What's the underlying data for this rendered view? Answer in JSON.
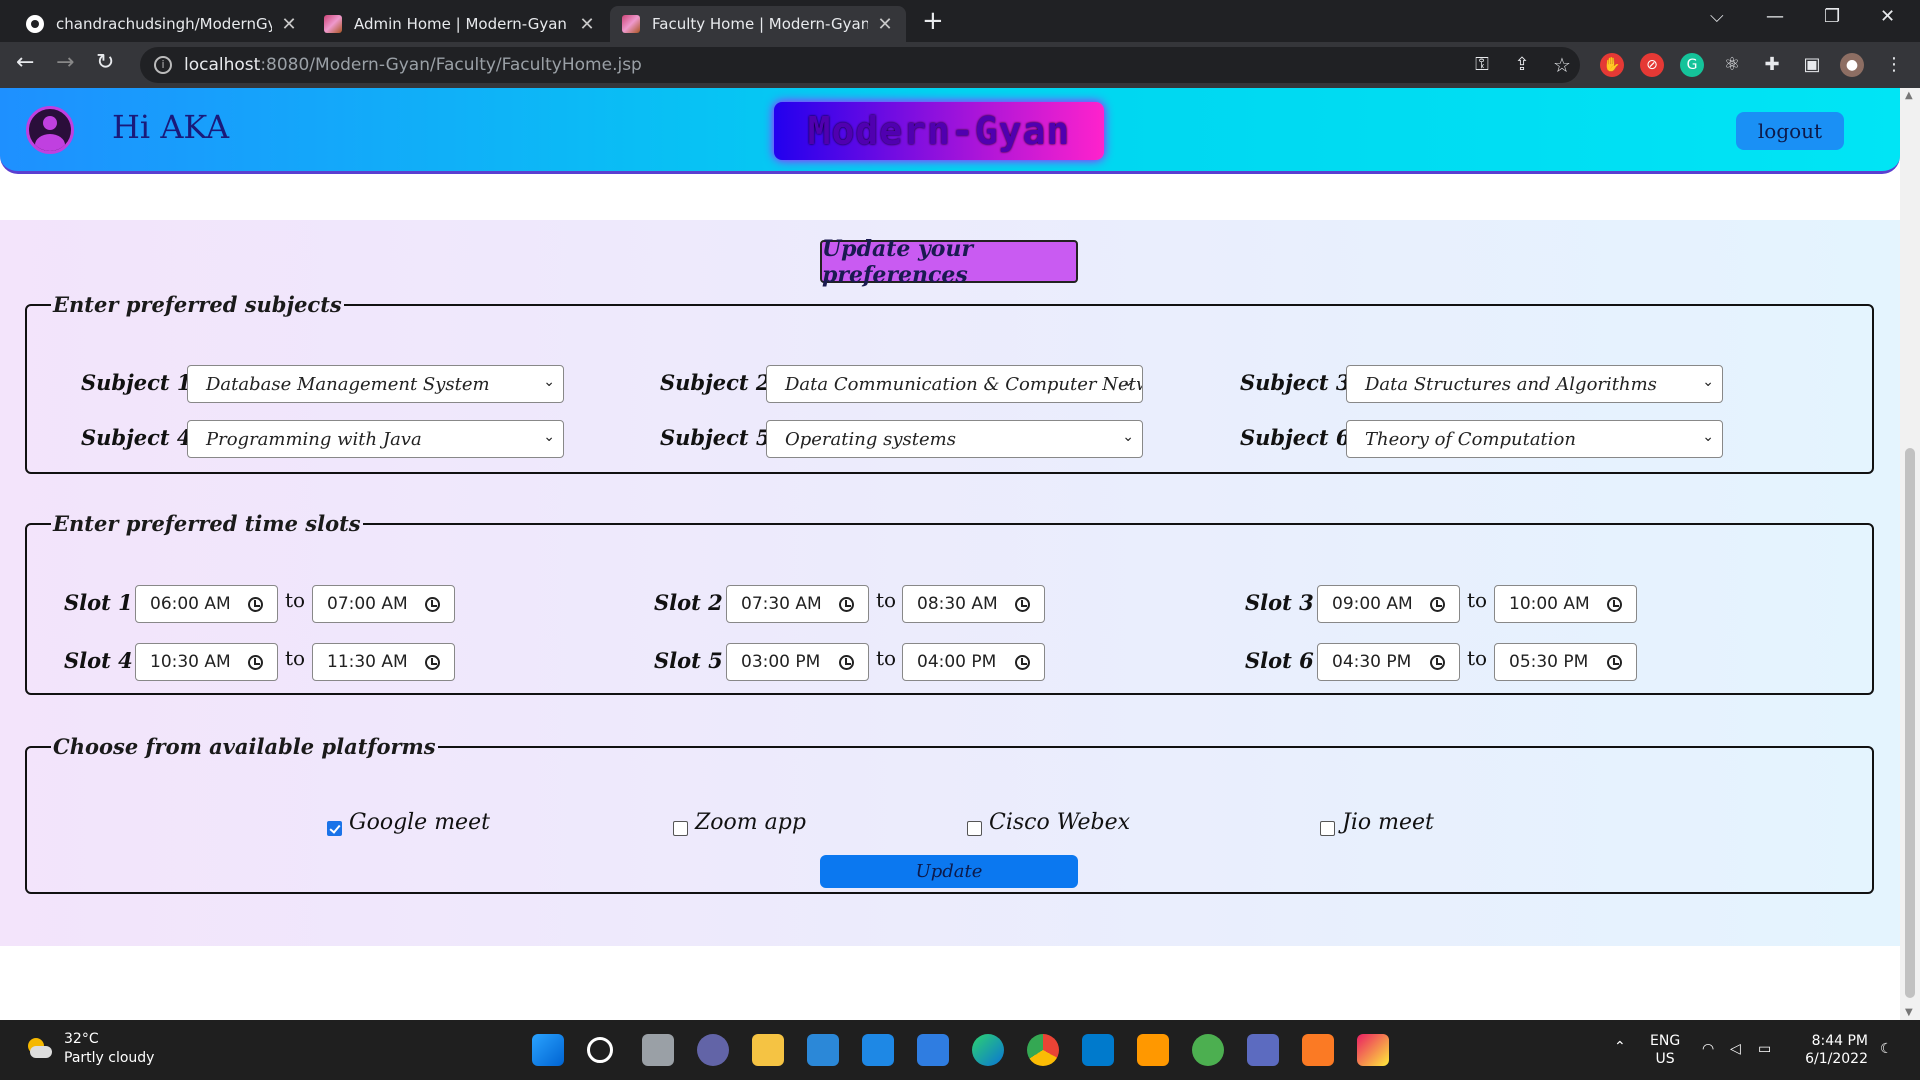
{
  "browser": {
    "tabs": [
      {
        "title": "chandrachudsingh/ModernGyan"
      },
      {
        "title": "Admin Home | Modern-Gyan"
      },
      {
        "title": "Faculty Home | Modern-Gyan"
      }
    ],
    "url_host": "localhost",
    "url_path": ":8080/Modern-Gyan/Faculty/FacultyHome.jsp"
  },
  "header": {
    "greeting": "Hi AKA",
    "logo_text": "Modern-Gyan",
    "logout_label": "logout"
  },
  "form": {
    "title": "Update your preferences",
    "subjects_legend": "Enter preferred subjects",
    "subjects": [
      {
        "label": "Subject 1 :",
        "value": "Database Management System"
      },
      {
        "label": "Subject 2 :",
        "value": "Data Communication & Computer Netw"
      },
      {
        "label": "Subject 3 :",
        "value": "Data Structures and Algorithms"
      },
      {
        "label": "Subject 4 :",
        "value": "Programming with Java"
      },
      {
        "label": "Subject 5 :",
        "value": "Operating systems"
      },
      {
        "label": "Subject 6 :",
        "value": "Theory of Computation"
      }
    ],
    "slots_legend": "Enter preferred time slots",
    "to_label": "to",
    "slots": [
      {
        "label": "Slot 1 :",
        "from": "06:00 AM",
        "to": "07:00 AM"
      },
      {
        "label": "Slot 2 :",
        "from": "07:30 AM",
        "to": "08:30 AM"
      },
      {
        "label": "Slot 3 :",
        "from": "09:00 AM",
        "to": "10:00 AM"
      },
      {
        "label": "Slot 4 :",
        "from": "10:30 AM",
        "to": "11:30 AM"
      },
      {
        "label": "Slot 5 :",
        "from": "03:00 PM",
        "to": "04:00 PM"
      },
      {
        "label": "Slot 6 :",
        "from": "04:30 PM",
        "to": "05:30 PM"
      }
    ],
    "platforms_legend": "Choose from available platforms",
    "platforms": [
      {
        "label": "Google meet",
        "checked": true
      },
      {
        "label": "Zoom app",
        "checked": false
      },
      {
        "label": "Cisco Webex",
        "checked": false
      },
      {
        "label": "Jio meet",
        "checked": false
      }
    ],
    "update_label": "Update"
  },
  "taskbar": {
    "temperature": "32°C",
    "weather": "Partly cloudy",
    "lang_top": "ENG",
    "lang_bottom": "US",
    "time": "8:44 PM",
    "date": "6/1/2022"
  }
}
